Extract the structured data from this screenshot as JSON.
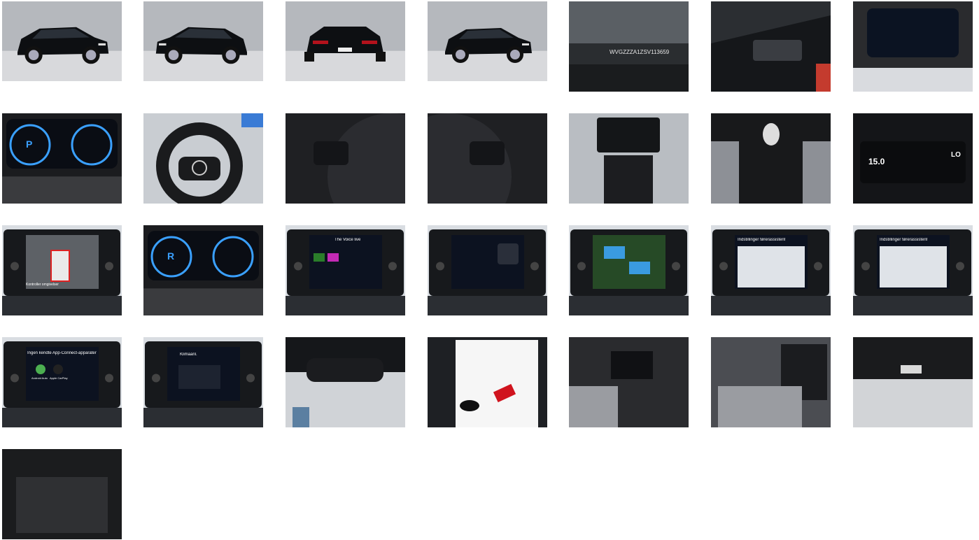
{
  "gallery": {
    "images": [
      {
        "kind": "ext-front-left"
      },
      {
        "kind": "ext-rear-left"
      },
      {
        "kind": "ext-rear"
      },
      {
        "kind": "ext-front-left-2"
      },
      {
        "kind": "windshield-vin",
        "text": "WVGZZZA1ZSV113659"
      },
      {
        "kind": "door-panel"
      },
      {
        "kind": "cluster-menu"
      },
      {
        "kind": "cluster-p",
        "gear": "P"
      },
      {
        "kind": "steering-wheel"
      },
      {
        "kind": "wheel-left"
      },
      {
        "kind": "wheel-right"
      },
      {
        "kind": "dash-center"
      },
      {
        "kind": "gear-shifter"
      },
      {
        "kind": "climate-panel",
        "left": "15.0",
        "right": "LO"
      },
      {
        "kind": "screen-camera",
        "warn": "Kontroller omgivelser"
      },
      {
        "kind": "cluster-r",
        "gear": "R"
      },
      {
        "kind": "screen-media",
        "title": "The Voice live"
      },
      {
        "kind": "screen-phone"
      },
      {
        "kind": "screen-park-assist"
      },
      {
        "kind": "screen-list",
        "title": "Indstillinger førerassistent"
      },
      {
        "kind": "screen-list-2",
        "title": "Indstillinger førerassistent"
      },
      {
        "kind": "screen-app-connect",
        "title": "Ingen kendte App-Connect-apparater",
        "a": "Android Auto",
        "b": "Apple CarPlay"
      },
      {
        "kind": "screen-climate",
        "title": "Klimaanl."
      },
      {
        "kind": "mirror"
      },
      {
        "kind": "papers-keys"
      },
      {
        "kind": "interior-front"
      },
      {
        "kind": "interior-rear"
      },
      {
        "kind": "trunk-lid"
      },
      {
        "kind": "trunk"
      }
    ]
  }
}
